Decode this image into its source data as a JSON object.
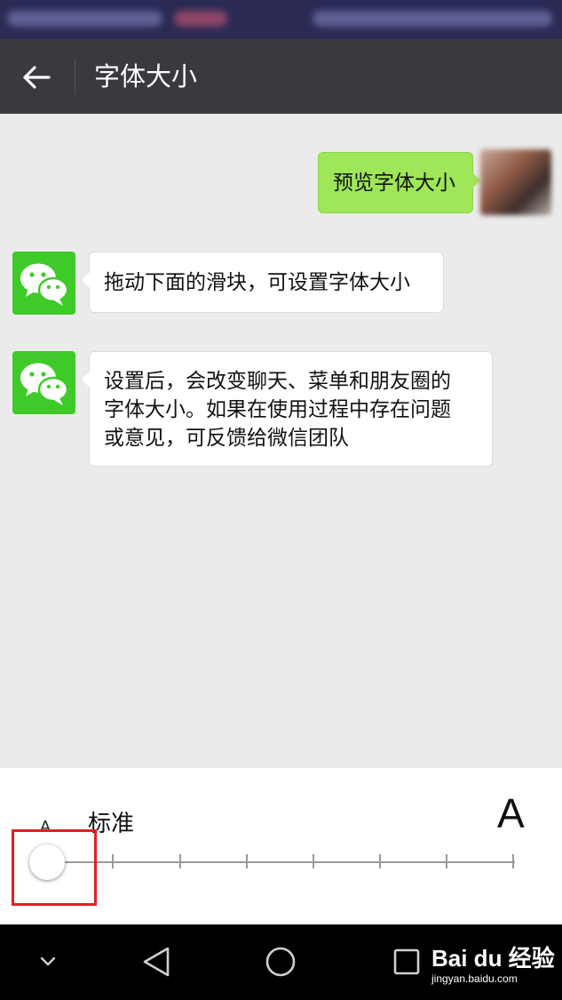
{
  "header": {
    "title": "字体大小",
    "back_icon": "arrow-left-icon"
  },
  "messages": [
    {
      "side": "right",
      "text": "预览字体大小"
    },
    {
      "side": "left",
      "sender_icon": "wechat-logo-icon",
      "text": "拖动下面的滑块，可设置字体大小"
    },
    {
      "side": "left",
      "sender_icon": "wechat-logo-icon",
      "lines": [
        "设置后，会改变聊天、菜单和朋友圈的",
        "字体大小。如果在使用过程中存在问题",
        "或意见，可反馈给微信团队"
      ]
    }
  ],
  "font_size_setting": {
    "small_label": "A",
    "current_label": "标准",
    "large_label": "A",
    "slider": {
      "steps": 8,
      "current_step": 0
    }
  },
  "nav": {
    "icons": [
      "chevron-down-icon",
      "back-triangle-icon",
      "home-circle-icon",
      "recents-square-icon"
    ]
  },
  "watermark": {
    "brand": "Bai du 经验",
    "url": "jingyan.baidu.com"
  },
  "colors": {
    "title_bar": "#393a3f",
    "chat_bg": "#ebebeb",
    "sent_bubble": "#9fe658",
    "wechat_green": "#3fca2a",
    "highlight": "#e02020"
  }
}
